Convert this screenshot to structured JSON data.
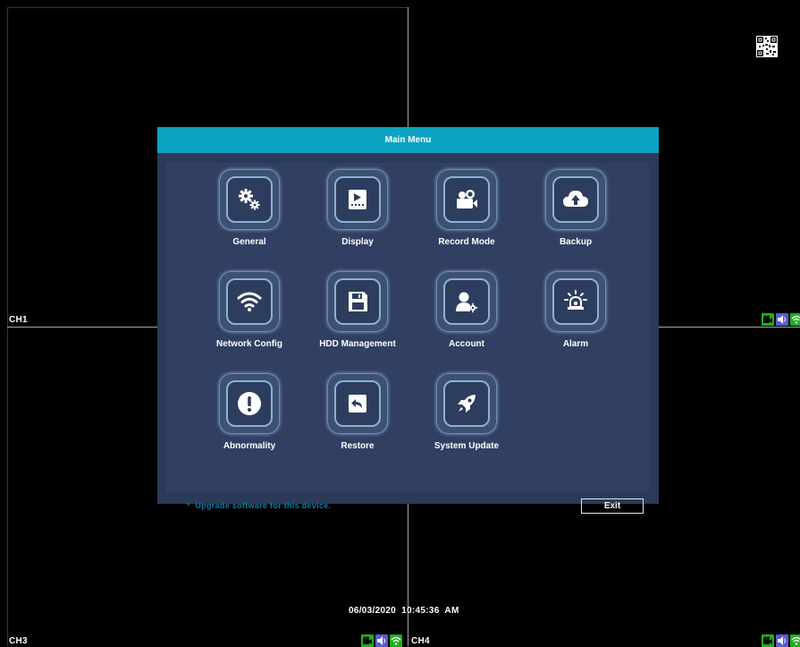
{
  "dialog": {
    "title": "Main Menu",
    "items": [
      {
        "label": "General",
        "icon": "gear-icon"
      },
      {
        "label": "Display",
        "icon": "display-icon"
      },
      {
        "label": "Record Mode",
        "icon": "camera-icon"
      },
      {
        "label": "Backup",
        "icon": "cloud-upload-icon"
      },
      {
        "label": "Network Config",
        "icon": "wifi-icon"
      },
      {
        "label": "HDD Management",
        "icon": "floppy-icon"
      },
      {
        "label": "Account",
        "icon": "account-icon"
      },
      {
        "label": "Alarm",
        "icon": "alarm-icon"
      },
      {
        "label": "Abnormality",
        "icon": "exclamation-icon"
      },
      {
        "label": "Restore",
        "icon": "restore-icon"
      },
      {
        "label": "System Update",
        "icon": "rocket-icon"
      }
    ],
    "hint": "*  Upgrade software for this device.",
    "exit_label": "Exit"
  },
  "channels": {
    "ch1": "CH1",
    "ch3": "CH3",
    "ch4": "CH4"
  },
  "timestamp": "06/03/2020  10:45:36  AM",
  "colors": {
    "header": "#0aa3c2",
    "dialog_bg": "#2a3a58",
    "hint": "#0e7da8",
    "record_indicator": "#1bb11b",
    "audio_indicator": "#5a5ad8"
  }
}
